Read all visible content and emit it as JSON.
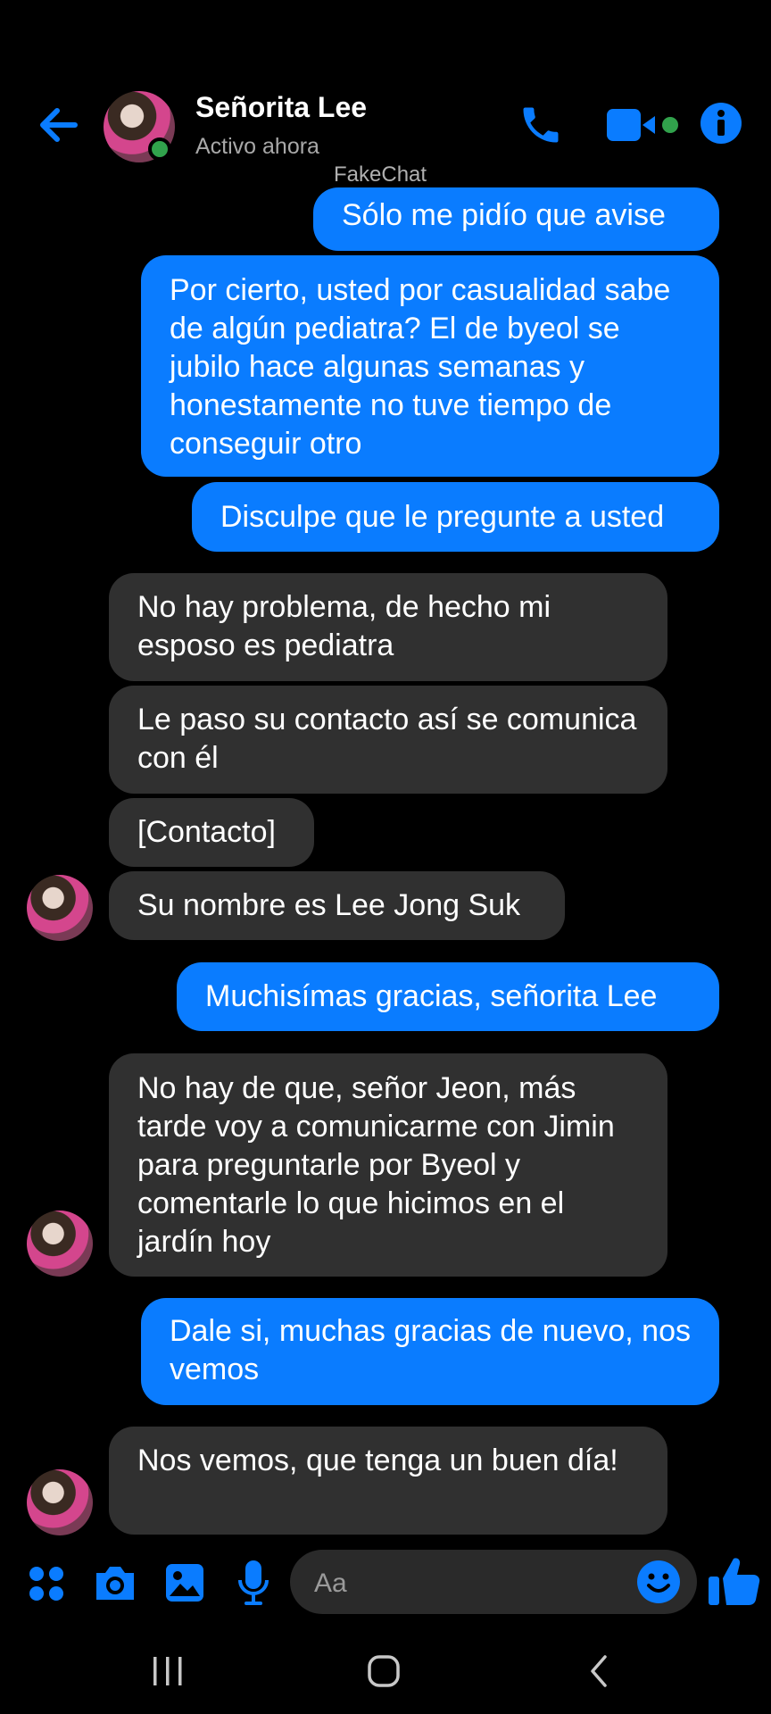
{
  "header": {
    "name": "Señorita Lee",
    "status": "Activo ahora",
    "watermark": "FakeChat",
    "colors": {
      "accent": "#0a7cff",
      "online": "#31a24c"
    },
    "icons": [
      "back-arrow-icon",
      "phone-icon",
      "video-camera-icon",
      "info-icon"
    ]
  },
  "messages": [
    {
      "from": "me",
      "text": "Sólo me pidío que avise"
    },
    {
      "from": "me",
      "text": "Por cierto, usted por casualidad sabe de algún pediatra? El de byeol se jubilo hace algunas semanas y honestamente no tuve tiempo de conseguir otro"
    },
    {
      "from": "me",
      "text": "Disculpe que le pregunte a usted"
    },
    {
      "from": "them",
      "text": "No hay problema, de hecho mi esposo es pediatra"
    },
    {
      "from": "them",
      "text": "Le paso su contacto así se comunica con él"
    },
    {
      "from": "them",
      "text": "[Contacto]"
    },
    {
      "from": "them",
      "text": "Su nombre es Lee Jong Suk"
    },
    {
      "from": "me",
      "text": "Muchisímas gracias, señorita Lee"
    },
    {
      "from": "them",
      "text": "No hay de que, señor Jeon, más tarde voy a comunicarme con Jimin para preguntarle por Byeol y comentarle lo que hicimos en el jardín hoy"
    },
    {
      "from": "me",
      "text": "Dale si, muchas gracias de nuevo, nos vemos"
    },
    {
      "from": "them",
      "text": "Nos vemos, que tenga un buen día!"
    }
  ],
  "composer": {
    "placeholder": "Aa",
    "icons": [
      "apps-icon",
      "camera-icon",
      "gallery-icon",
      "microphone-icon",
      "emoji-icon",
      "thumbs-up-icon"
    ]
  },
  "navbar": {
    "icons": [
      "recents-icon",
      "home-icon",
      "back-icon"
    ]
  }
}
